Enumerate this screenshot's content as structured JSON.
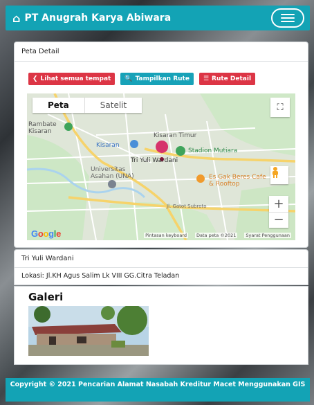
{
  "navbar": {
    "brand": "PT Anugrah Karya Abiwara"
  },
  "map_card": {
    "header": "Peta Detail",
    "buttons": {
      "all_places": "Lihat semua tempat",
      "show_route": "Tampilkan Rute",
      "route_detail": "Rute Detail"
    },
    "map": {
      "tab_map": "Peta",
      "tab_satellite": "Satelit",
      "labels": {
        "rambate": "Rambate Kisaran",
        "kisaran_timur": "Kisaran Timur",
        "kisaran": "Kisaran",
        "stadion": "Stadion Mutiara",
        "marker": "Tri Yuli Wardani",
        "universitas": "Universitas Asahan (UNA)",
        "es_gak_beres": "Es Gak Beres Cafe & Rooftop",
        "road": "Jl. Gatot Subroto"
      },
      "footer": {
        "keyboard": "Pintasan keyboard",
        "data": "Data peta ©2021",
        "terms": "Syarat Penggunaan"
      },
      "logo": "Google"
    }
  },
  "detail_card": {
    "header": "Tri Yuli Wardani",
    "location": "Lokasi: Jl.KH Agus Salim Lk VIII GG.Citra Teladan"
  },
  "gallery": {
    "title": "Galeri"
  },
  "footer": {
    "text": "Copyright © 2021 Pencarian Alamat Nasabah Kreditur Macet Menggunakan GIS"
  },
  "colors": {
    "brand": "#13a3b5",
    "danger": "#dc3545",
    "info": "#17a2b8"
  }
}
